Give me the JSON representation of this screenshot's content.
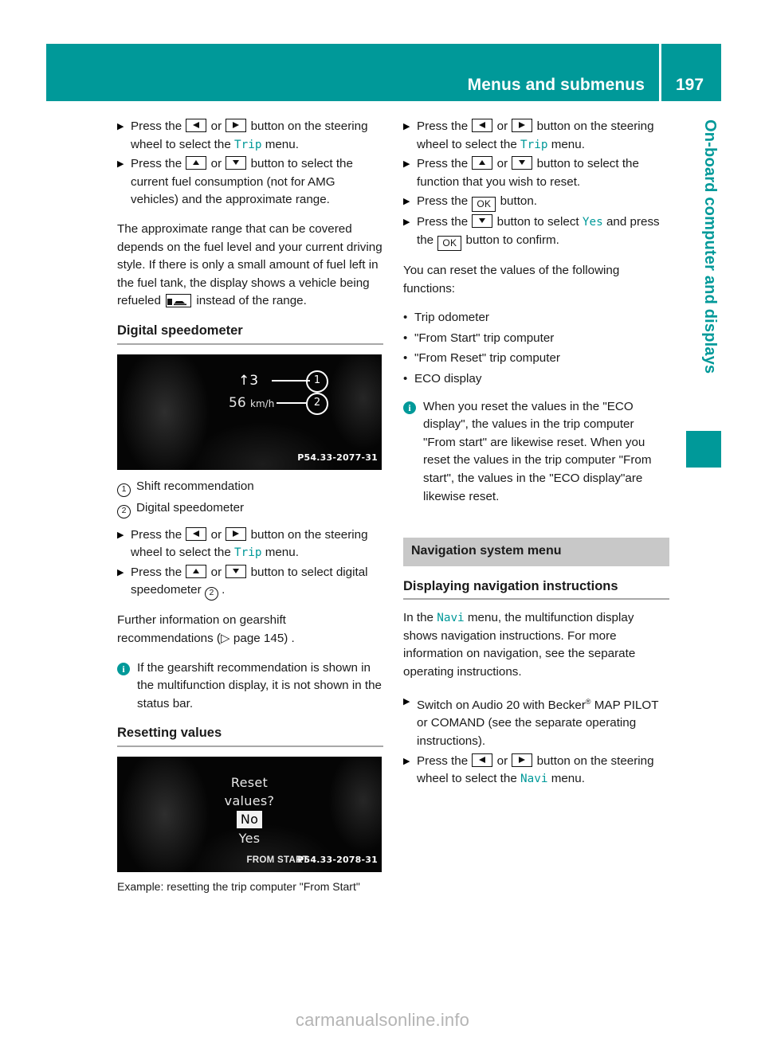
{
  "header": {
    "title": "Menus and submenus",
    "page_number": "197",
    "accent_color": "#009999"
  },
  "chapter_tab": {
    "label": "On-board computer and displays"
  },
  "left_column": {
    "step1": {
      "prefix": "Press the",
      "key_left": "left-arrow",
      "or": "or",
      "key_right": "right-arrow",
      "middle": "button on the steering wheel to select the",
      "term": "Trip",
      "suffix": "menu."
    },
    "step2": {
      "prefix": "Press the",
      "key_up": "up-arrow",
      "or": "or",
      "key_down": "down-arrow",
      "suffix": "button to select the current fuel consumption (not for AMG vehicles) and the approximate range."
    },
    "range_para_1": "The approximate range that can be covered depends on the fuel level and your current driving style. If there is only a small amount of fuel left in the fuel tank, the display shows a vehicle being refueled",
    "range_para_2": "instead of the range.",
    "heading_speedometer": "Digital speedometer",
    "figure_speedometer": {
      "gear_indicator": "3",
      "gear_arrow": "↑",
      "speed_value": "56",
      "speed_unit": "km/h",
      "callout_1": "1",
      "callout_2": "2",
      "code": "P54.33-2077-31"
    },
    "callouts": [
      {
        "num": "1",
        "label": "Shift recommendation"
      },
      {
        "num": "2",
        "label": "Digital speedometer"
      }
    ],
    "step3": {
      "prefix": "Press the",
      "key_left": "left-arrow",
      "or": "or",
      "key_right": "right-arrow",
      "middle": "button on the steering wheel to select the",
      "term": "Trip",
      "suffix": "menu."
    },
    "step4": {
      "prefix": "Press the",
      "key_up": "up-arrow",
      "or": "or",
      "key_down": "down-arrow",
      "middle": "button to select digital speedometer",
      "ref_num": "2",
      "suffix": "."
    },
    "further_info_1": "Further information on gearshift recommendations (",
    "further_info_ref": "page 145",
    "further_info_2": ") .",
    "note": "If the gearshift recommendation is shown in the multifunction display, it is not shown in the status bar.",
    "heading_resetting": "Resetting values",
    "figure_reset": {
      "line1": "Reset",
      "line2": "values?",
      "option_no": "No",
      "option_yes": "Yes",
      "status": "FROM START",
      "code": "P54.33-2078-31"
    },
    "figure_reset_caption": "Example: resetting the trip computer \"From Start\""
  },
  "right_column": {
    "step1": {
      "prefix": "Press the",
      "key_left": "left-arrow",
      "or": "or",
      "key_right": "right-arrow",
      "middle": "button on the steering wheel to select the",
      "term": "Trip",
      "suffix": "menu."
    },
    "step2": {
      "prefix": "Press the",
      "key_up": "up-arrow",
      "or": "or",
      "key_down": "down-arrow",
      "suffix": "button to select the function that you wish to reset."
    },
    "step3": {
      "prefix": "Press the",
      "key_ok": "OK",
      "suffix": "button."
    },
    "step4": {
      "prefix": "Press the",
      "key_down": "down-arrow",
      "middle": "button to select",
      "term": "Yes",
      "middle2": "and press the",
      "key_ok": "OK",
      "suffix": "button to confirm."
    },
    "reset_intro": "You can reset the values of the following functions:",
    "reset_list": [
      "Trip odometer",
      "\"From Start\" trip computer",
      "\"From Reset\" trip computer",
      "ECO display"
    ],
    "note": "When you reset the values in the \"ECO display\", the values in the trip computer \"From start\" are likewise reset. When you reset the values in the trip computer \"From start\", the values in the \"ECO display\"are likewise reset.",
    "section_bar": "Navigation system menu",
    "heading_navigation": "Displaying navigation instructions",
    "nav_para_1": "In the",
    "nav_term": "Navi",
    "nav_para_2": "menu, the multifunction display shows navigation instructions. For more information on navigation, see the separate operating instructions.",
    "step5": {
      "prefix": "Switch on Audio 20 with Becker",
      "registered": "®",
      "suffix": "MAP PILOT or COMAND (see the separate operating instructions)."
    },
    "step6": {
      "prefix": "Press the",
      "key_left": "left-arrow",
      "or": "or",
      "key_right": "right-arrow",
      "middle": "button on the steering wheel to select the",
      "term": "Navi",
      "suffix": "menu."
    }
  },
  "watermark": "carmanualsonline.info",
  "markers": {
    "step_arrow": "▶",
    "bullet": "•",
    "ref_arrow": "▷",
    "info": "i"
  }
}
